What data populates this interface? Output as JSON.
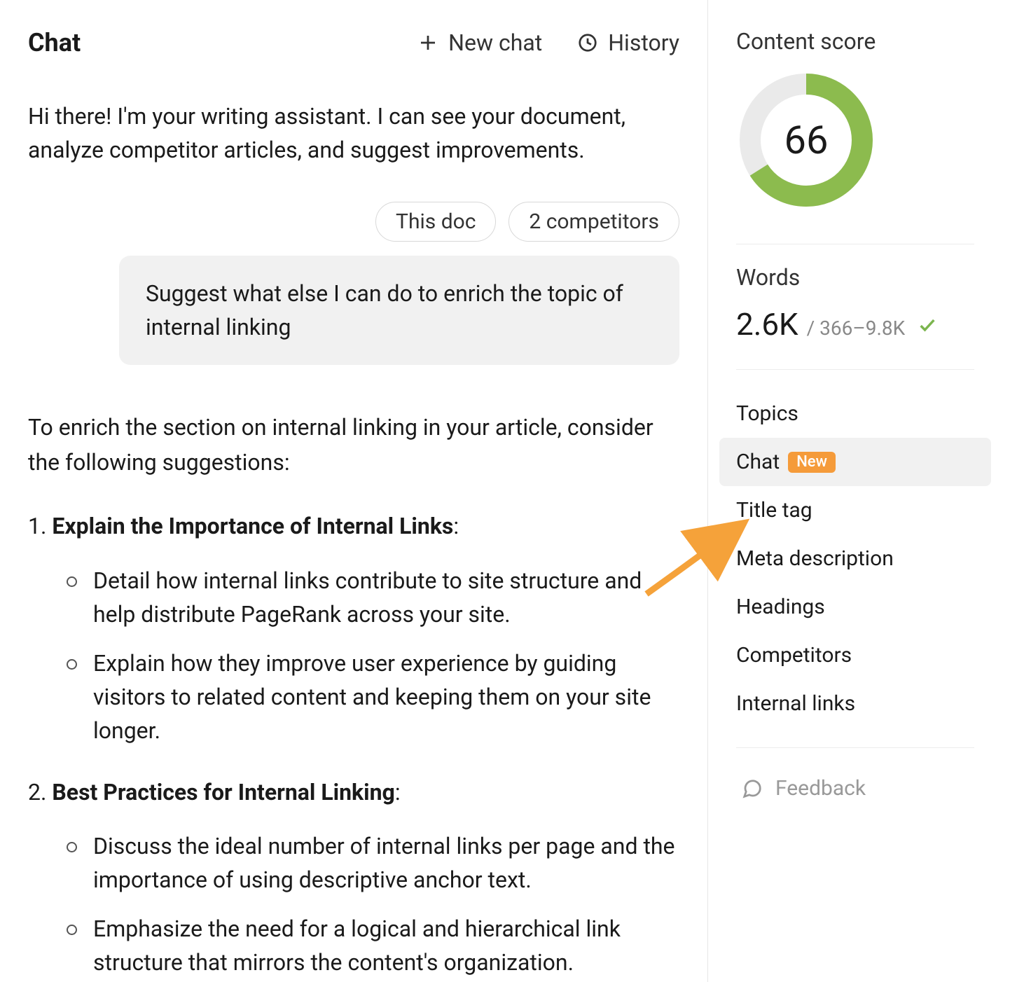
{
  "chat": {
    "title": "Chat",
    "new_chat_label": "New chat",
    "history_label": "History",
    "greeting": "Hi there! I'm your writing assistant. I can see your document, analyze competitor articles, and suggest improvements.",
    "chips": {
      "this_doc": "This doc",
      "competitors": "2 competitors"
    },
    "user_message": "Suggest what else I can do to enrich the topic of internal linking",
    "assistant_intro": "To enrich the section on internal linking in your article, consider the following suggestions:",
    "suggestions": [
      {
        "number": "1.",
        "title": "Explain the Importance of Internal Links",
        "colon": ":",
        "points": [
          "Detail how internal links contribute to site structure and help distribute PageRank across your site.",
          "Explain how they improve user experience by guiding visitors to related content and keeping them on your site longer."
        ]
      },
      {
        "number": "2.",
        "title": "Best Practices for Internal Linking",
        "colon": ":",
        "points": [
          "Discuss the ideal number of internal links per page and the importance of using descriptive anchor text.",
          "Emphasize the need for a logical and hierarchical link structure that mirrors the content's organization."
        ]
      }
    ]
  },
  "sidebar": {
    "content_score_label": "Content score",
    "content_score_value": "66",
    "content_score_pct": 66,
    "words_label": "Words",
    "words_value": "2.6K",
    "words_range": "/ 366–9.8K",
    "nav": {
      "topics": "Topics",
      "chat": "Chat",
      "chat_badge": "New",
      "title_tag": "Title tag",
      "meta_description": "Meta description",
      "headings": "Headings",
      "competitors": "Competitors",
      "internal_links": "Internal links"
    },
    "feedback_label": "Feedback"
  },
  "colors": {
    "accent_green": "#8cbb4e",
    "badge_orange": "#f59b3a",
    "arrow_orange": "#f5a23a"
  }
}
